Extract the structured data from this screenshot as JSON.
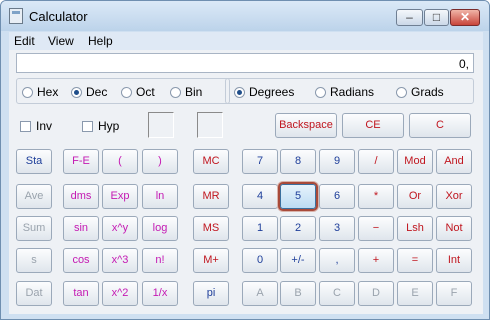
{
  "window": {
    "title": "Calculator",
    "min_glyph": "‒",
    "max_glyph": "□",
    "close_glyph": "✕"
  },
  "menu": [
    "Edit",
    "View",
    "Help"
  ],
  "display": {
    "value": "0,"
  },
  "radix": [
    {
      "label": "Hex",
      "selected": false
    },
    {
      "label": "Dec",
      "selected": true
    },
    {
      "label": "Oct",
      "selected": false
    },
    {
      "label": "Bin",
      "selected": false
    }
  ],
  "angle": [
    {
      "label": "Degrees",
      "selected": true
    },
    {
      "label": "Radians",
      "selected": false
    },
    {
      "label": "Grads",
      "selected": false
    }
  ],
  "checkboxes": [
    {
      "label": "Inv",
      "checked": false
    },
    {
      "label": "Hyp",
      "checked": false
    }
  ],
  "edit_buttons": [
    "Backspace",
    "CE",
    "C"
  ],
  "keys": {
    "col0": [
      "Sta",
      "Ave",
      "Sum",
      "s",
      "Dat"
    ],
    "col1": [
      "F-E",
      "dms",
      "sin",
      "cos",
      "tan"
    ],
    "col2": [
      "(",
      "Exp",
      "x^y",
      "x^3",
      "x^2"
    ],
    "col3": [
      ")",
      "ln",
      "log",
      "n!",
      "1/x"
    ],
    "memory": [
      "MC",
      "MR",
      "MS",
      "M+",
      "pi"
    ],
    "pad": [
      [
        "7",
        "8",
        "9",
        "/",
        "Mod",
        "And"
      ],
      [
        "4",
        "5",
        "6",
        "*",
        "Or",
        "Xor"
      ],
      [
        "1",
        "2",
        "3",
        "−",
        "Lsh",
        "Not"
      ],
      [
        "0",
        "+/-",
        ",",
        "+",
        "=",
        "Int"
      ],
      [
        "A",
        "B",
        "C",
        "D",
        "E",
        "F"
      ]
    ]
  },
  "pressed_key": "5",
  "colors": {
    "blue_keys": "#1f3f9a",
    "red_keys": "#c0161f",
    "magenta_keys": "#c41ab3",
    "disabled_keys": "#9aa3ad",
    "pressed_outline": "#a84a3a"
  }
}
